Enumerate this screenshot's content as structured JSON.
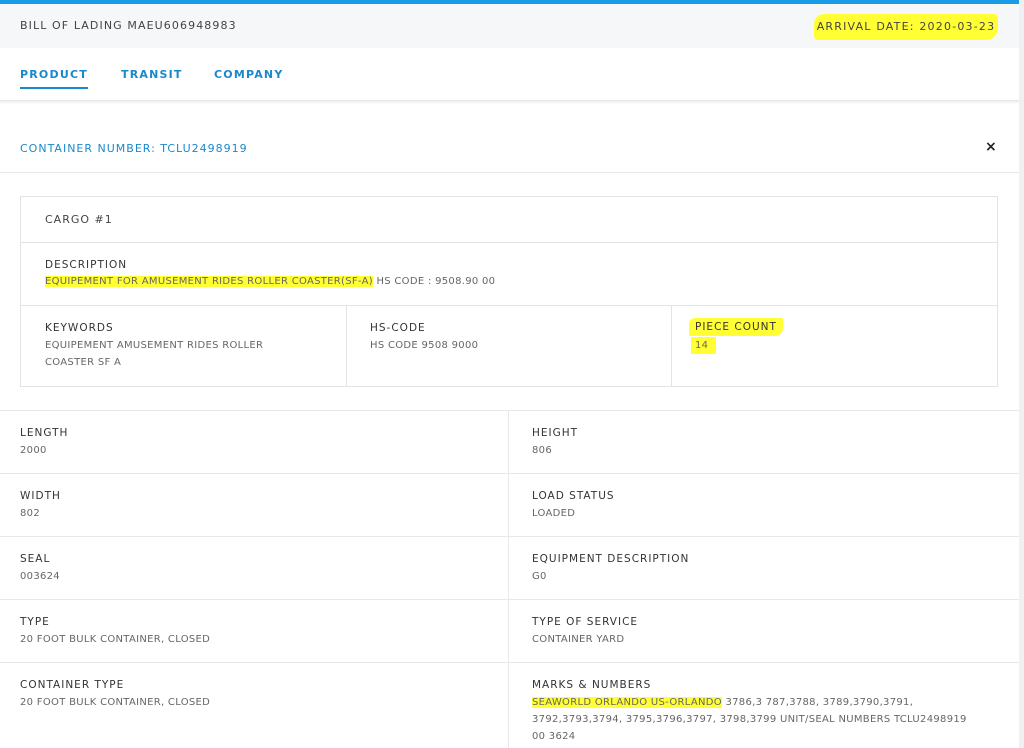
{
  "header": {
    "bol_label": "BILL OF LADING MAEU606948983",
    "arrival_label": "ARRIVAL DATE: 2020-03-23"
  },
  "tabs": [
    {
      "label": "PRODUCT",
      "active": true
    },
    {
      "label": "TRANSIT",
      "active": false
    },
    {
      "label": "COMPANY",
      "active": false
    }
  ],
  "container": {
    "label": "CONTAINER NUMBER: TCLU2498919",
    "close_icon": "×"
  },
  "cargo": {
    "title": "CARGO #1",
    "description_label": "DESCRIPTION",
    "description_highlight": "EQUIPEMENT FOR AMUSEMENT RIDES ROLLER COASTER(SF-A)",
    "description_rest": " HS CODE : 9508.90 00",
    "keywords_label": "KEYWORDS",
    "keywords_value": "EQUIPEMENT AMUSEMENT RIDES ROLLER COASTER SF A",
    "hscode_label": "HS-CODE",
    "hscode_value": "HS CODE 9508 9000",
    "piece_count_label": "PIECE COUNT",
    "piece_count_value": "14"
  },
  "details": {
    "length_label": "LENGTH",
    "length_value": "2000",
    "height_label": "HEIGHT",
    "height_value": "806",
    "width_label": "WIDTH",
    "width_value": "802",
    "load_status_label": "LOAD STATUS",
    "load_status_value": "LOADED",
    "seal_label": "SEAL",
    "seal_value": "003624",
    "equipment_label": "EQUIPMENT DESCRIPTION",
    "equipment_value": "G0",
    "type_label": "TYPE",
    "type_value": "20 FOOT BULK CONTAINER, CLOSED",
    "service_label": "TYPE OF SERVICE",
    "service_value": "CONTAINER YARD",
    "container_type_label": "CONTAINER TYPE",
    "container_type_value": "20 FOOT BULK CONTAINER, CLOSED",
    "marks_label": "MARKS & NUMBERS",
    "marks_highlight": "SEAWORLD ORLANDO US-ORLANDO",
    "marks_rest": " 3786,3 787,3788, 3789,3790,3791, 3792,3793,3794, 3795,3796,3797, 3798,3799 UNIT/SEAL NUMBERS TCLU2498919 00 3624"
  },
  "colors": {
    "accent": "#1a88cc",
    "highlight": "#ffff33"
  }
}
